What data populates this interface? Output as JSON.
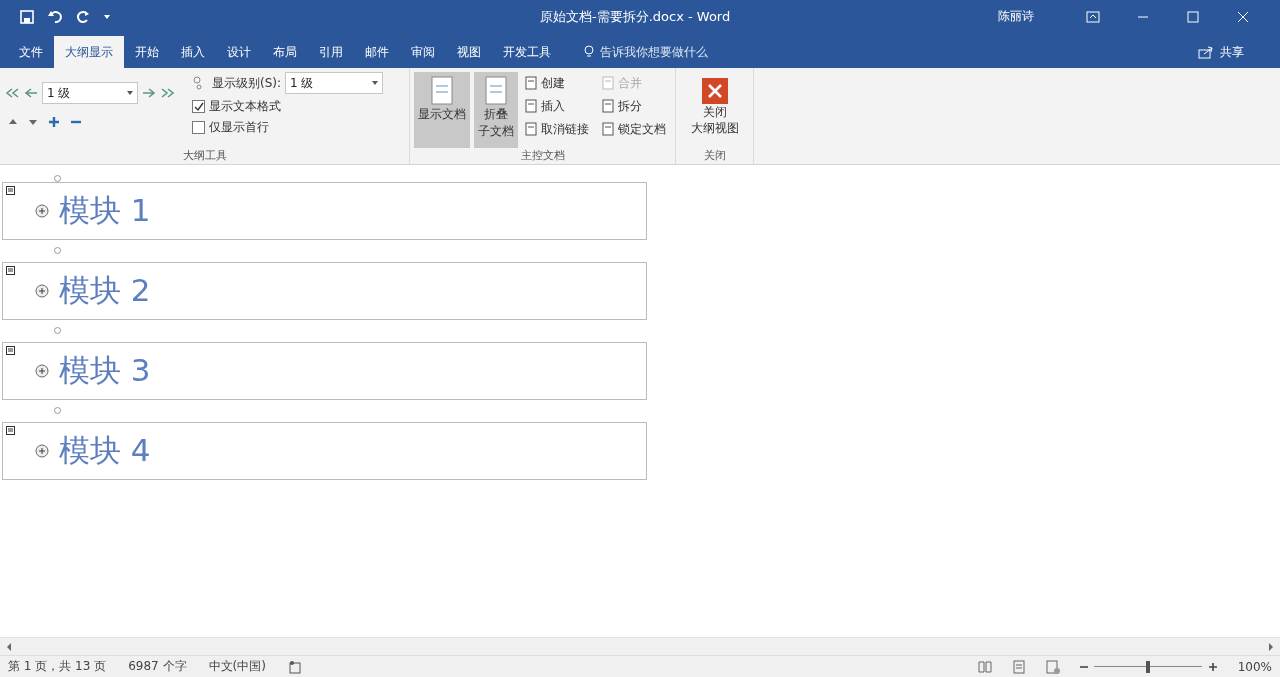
{
  "title_bar": {
    "title": "原始文档-需要拆分.docx  -  Word",
    "user": "陈丽诗"
  },
  "tabs": [
    {
      "label": "文件",
      "selected": false
    },
    {
      "label": "大纲显示",
      "selected": true
    },
    {
      "label": "开始",
      "selected": false
    },
    {
      "label": "插入",
      "selected": false
    },
    {
      "label": "设计",
      "selected": false
    },
    {
      "label": "布局",
      "selected": false
    },
    {
      "label": "引用",
      "selected": false
    },
    {
      "label": "邮件",
      "selected": false
    },
    {
      "label": "审阅",
      "selected": false
    },
    {
      "label": "视图",
      "selected": false
    },
    {
      "label": "开发工具",
      "selected": false
    }
  ],
  "tell_me": "告诉我你想要做什么",
  "share": "共享",
  "outline_tools": {
    "level_value": "1 级",
    "show_level_label": "显示级别(S):",
    "show_level_value": "1 级",
    "options": [
      {
        "label": "显示文本格式",
        "checked": true
      },
      {
        "label": "仅显示首行",
        "checked": false
      }
    ],
    "group_label": "大纲工具"
  },
  "master_document": {
    "large_buttons": [
      {
        "lines": [
          "显示文档"
        ],
        "pressed": true
      },
      {
        "lines": [
          "折叠",
          "子文档"
        ],
        "pressed": true
      }
    ],
    "small_buttons": [
      {
        "label": "创建",
        "disabled": false
      },
      {
        "label": "插入",
        "disabled": false
      },
      {
        "label": "取消链接",
        "disabled": false
      },
      {
        "label": "合并",
        "disabled": true
      },
      {
        "label": "拆分",
        "disabled": false
      },
      {
        "label": "锁定文档",
        "disabled": false
      }
    ],
    "group_label": "主控文档"
  },
  "close_group": {
    "button_lines": [
      "关闭",
      "大纲视图"
    ],
    "group_label": "关闭"
  },
  "document": {
    "subdocuments": [
      {
        "heading": "模块 1"
      },
      {
        "heading": "模块 2"
      },
      {
        "heading": "模块 3"
      },
      {
        "heading": "模块 4"
      }
    ]
  },
  "status_bar": {
    "page": "第 1 页，共 13 页",
    "words": "6987 个字",
    "language": "中文(中国)",
    "level": 0.5,
    "zoom": "100%"
  }
}
